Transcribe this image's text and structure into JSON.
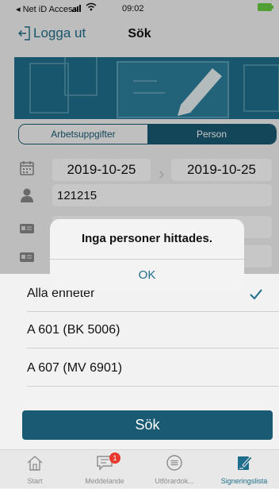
{
  "status_bar": {
    "carrier": "◂ Net iD Access",
    "time": "09:02"
  },
  "nav": {
    "logout_label": "Logga ut",
    "title": "Sök"
  },
  "segments": [
    {
      "label": "Arbetsuppgifter"
    },
    {
      "label": "Person"
    }
  ],
  "date_range": {
    "from": "2019-10-25",
    "to": "2019-10-25"
  },
  "person_id": "121215",
  "units": [
    {
      "label": "Alla enheter",
      "selected": true
    },
    {
      "label": "A 601 (BK 5006)"
    },
    {
      "label": "A 607 (MV 6901)"
    }
  ],
  "alert": {
    "message": "Inga personer hittades.",
    "ok_label": "OK"
  },
  "search_button": "Sök",
  "tabs": [
    {
      "label": "Start",
      "icon": "home-icon"
    },
    {
      "label": "Meddelande",
      "icon": "message-icon",
      "badge": "1"
    },
    {
      "label": "Utförardok...",
      "icon": "document-icon"
    },
    {
      "label": "Signeringslista",
      "icon": "sign-icon"
    }
  ],
  "colors": {
    "accent": "#1a5a72",
    "link": "#1e6d8a",
    "badge": "#e8392c"
  }
}
